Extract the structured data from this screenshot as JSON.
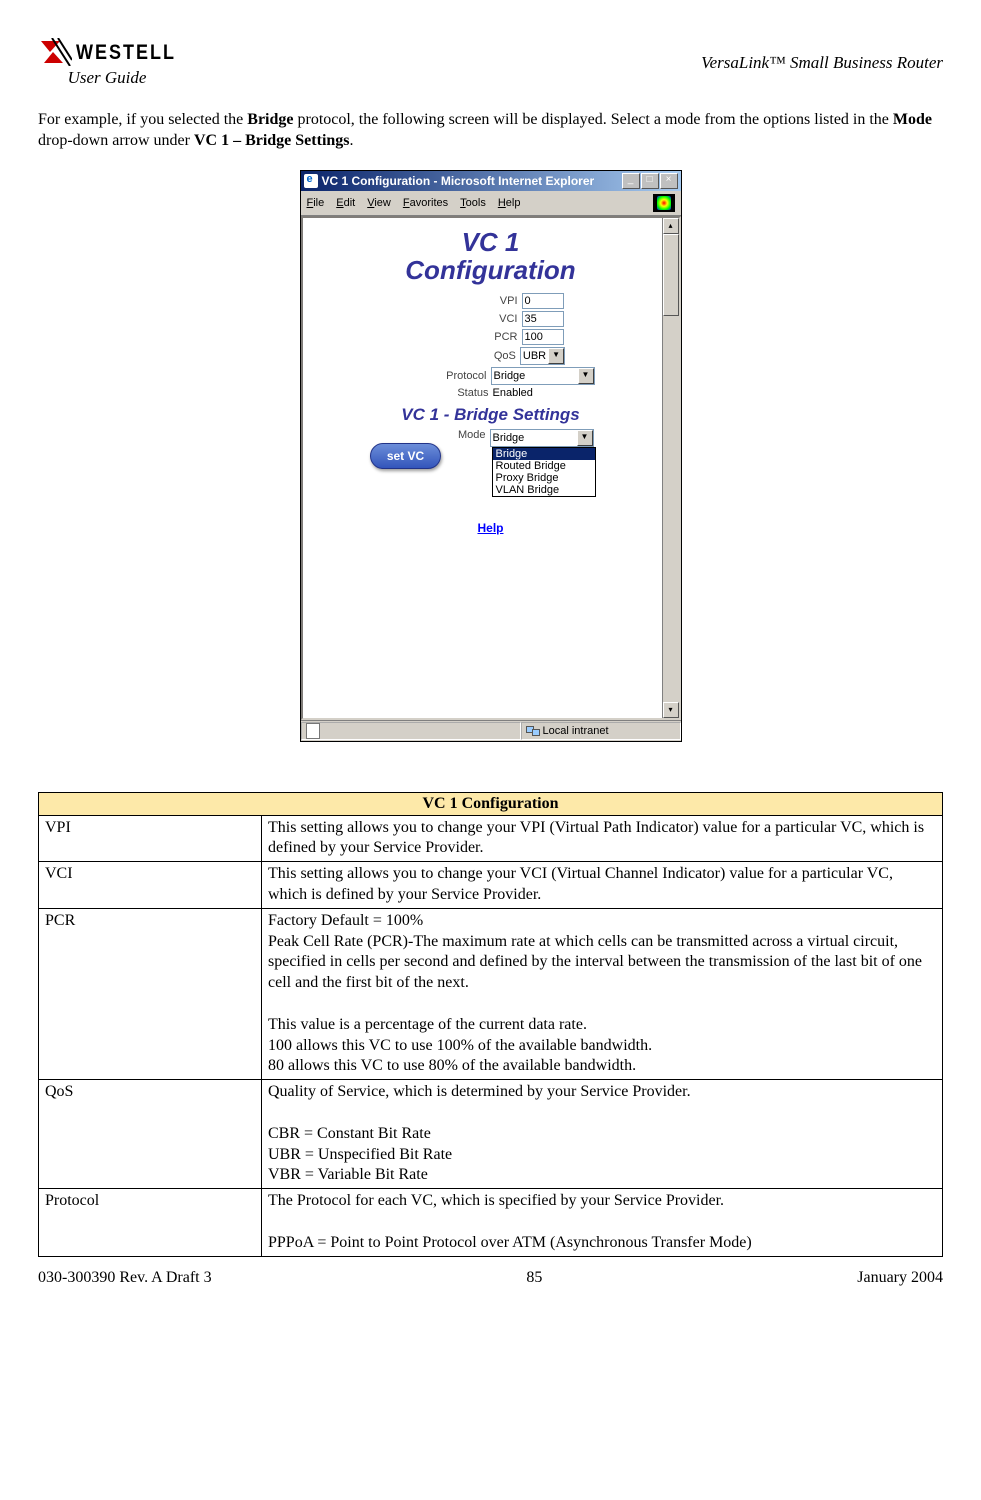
{
  "header": {
    "brand": "WESTELL",
    "user_guide": "User Guide",
    "right": "VersaLink™  Small Business Router"
  },
  "intro": {
    "line1_a": "For example, if you selected the ",
    "line1_b": "Bridge",
    "line1_c": " protocol, the following screen will be displayed. Select a mode from the options listed in the ",
    "line1_d": "Mode",
    "line1_e": " drop-down arrow under ",
    "line1_f": "VC 1 – Bridge Settings",
    "line1_g": "."
  },
  "window": {
    "title": "VC 1 Configuration - Microsoft Internet Explorer",
    "menus": [
      "File",
      "Edit",
      "View",
      "Favorites",
      "Tools",
      "Help"
    ],
    "heading1": "VC 1",
    "heading2": "Configuration",
    "fields": {
      "vpi_label": "VPI",
      "vpi_value": "0",
      "vci_label": "VCI",
      "vci_value": "35",
      "pcr_label": "PCR",
      "pcr_value": "100",
      "qos_label": "QoS",
      "qos_value": "UBR",
      "protocol_label": "Protocol",
      "protocol_value": "Bridge",
      "status_label": "Status",
      "status_value": "Enabled"
    },
    "heading_bridge": "VC 1 - Bridge Settings",
    "mode_label": "Mode",
    "mode_value": "Bridge",
    "mode_options": [
      "Bridge",
      "Routed Bridge",
      "Proxy Bridge",
      "VLAN Bridge"
    ],
    "set_vc": "set VC",
    "help": "Help",
    "status_zone": "Local intranet"
  },
  "table": {
    "title": "VC 1 Configuration",
    "rows": [
      {
        "name": "VPI",
        "desc": "This setting allows you to change your VPI (Virtual Path Indicator) value for a particular VC, which is defined by your Service Provider."
      },
      {
        "name": "VCI",
        "desc": "This setting allows you to change your VCI (Virtual Channel Indicator) value for a particular VC, which is defined by your Service Provider."
      },
      {
        "name": "PCR",
        "desc": "Factory Default = 100%\nPeak Cell Rate (PCR)-The maximum rate at which cells can be transmitted across a virtual circuit, specified in cells per second and defined by the interval between the transmission of the last bit of one cell and the first bit of the next.\n\nThis value is a percentage of the current data rate.\n100 allows this VC to use 100% of the available bandwidth.\n80 allows this VC to use 80% of the available bandwidth."
      },
      {
        "name": "QoS",
        "desc": "Quality of Service, which is determined by your Service Provider.\n\nCBR = Constant Bit Rate\nUBR = Unspecified Bit Rate\nVBR = Variable Bit Rate"
      },
      {
        "name": "Protocol",
        "desc": "The Protocol for each VC, which is specified by your Service Provider.\n\nPPPoA = Point to Point Protocol over ATM (Asynchronous Transfer Mode)"
      }
    ]
  },
  "footer": {
    "left": "030-300390 Rev. A Draft 3",
    "center": "85",
    "right": "January 2004"
  }
}
